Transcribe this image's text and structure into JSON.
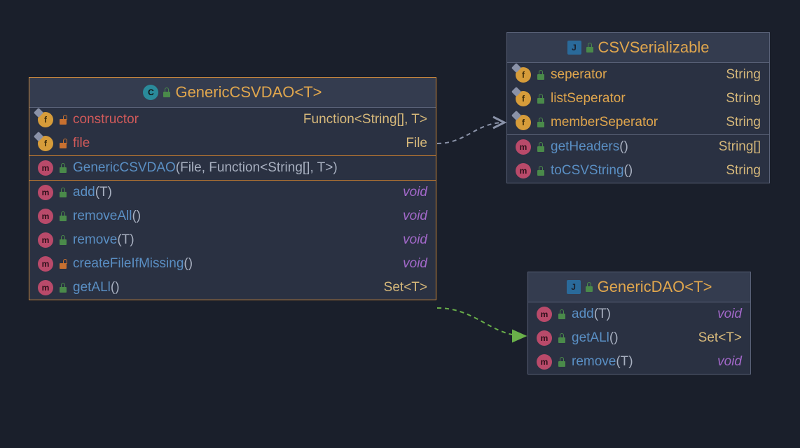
{
  "class1": {
    "title": "GenericCSVDAO<T>",
    "fields": [
      {
        "name": "constructor",
        "type": "Function<String[], T>",
        "vis": "private"
      },
      {
        "name": "file",
        "type": "File",
        "vis": "private"
      }
    ],
    "ctor": {
      "name": "GenericCSVDAO",
      "params": "(File, Function<String[], T>)"
    },
    "methods": [
      {
        "name": "add",
        "params": "(T)",
        "ret": "void",
        "vis": "public"
      },
      {
        "name": "removeAll",
        "params": "()",
        "ret": "void",
        "vis": "public"
      },
      {
        "name": "remove",
        "params": "(T)",
        "ret": "void",
        "vis": "public"
      },
      {
        "name": "createFileIfMissing",
        "params": "()",
        "ret": "void",
        "vis": "protected"
      },
      {
        "name": "getALl",
        "params": "()",
        "ret": "Set<T>",
        "vis": "public"
      }
    ]
  },
  "class2": {
    "title": "CSVSerializable",
    "fields": [
      {
        "name": "seperator",
        "type": "String"
      },
      {
        "name": "listSeperator",
        "type": "String"
      },
      {
        "name": "memberSeperator",
        "type": "String"
      }
    ],
    "methods": [
      {
        "name": "getHeaders",
        "params": "()",
        "ret": "String[]"
      },
      {
        "name": "toCSVString",
        "params": "()",
        "ret": "String"
      }
    ]
  },
  "class3": {
    "title": "GenericDAO<T>",
    "methods": [
      {
        "name": "add",
        "params": "(T)",
        "ret": "void"
      },
      {
        "name": "getALl",
        "params": "()",
        "ret": "Set<T>"
      },
      {
        "name": "remove",
        "params": "(T)",
        "ret": "void"
      }
    ]
  }
}
